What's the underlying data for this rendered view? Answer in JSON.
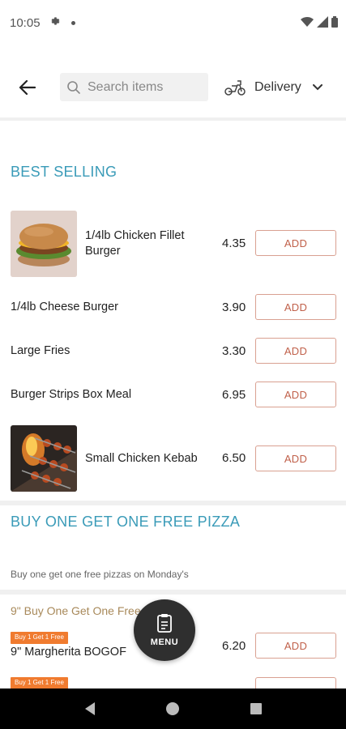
{
  "status_bar": {
    "time": "10:05"
  },
  "header": {
    "search_placeholder": "Search items",
    "delivery_label": "Delivery"
  },
  "sections": [
    {
      "title": "BEST SELLING",
      "items": [
        {
          "name": "1/4lb Chicken Fillet Burger",
          "price": "4.35",
          "add_label": "ADD"
        },
        {
          "name": "1/4lb Cheese Burger",
          "price": "3.90",
          "add_label": "ADD"
        },
        {
          "name": "Large Fries",
          "price": "3.30",
          "add_label": "ADD"
        },
        {
          "name": "Burger Strips Box Meal",
          "price": "6.95",
          "add_label": "ADD"
        },
        {
          "name": "Small Chicken Kebab",
          "price": "6.50",
          "add_label": "ADD"
        }
      ]
    },
    {
      "title": "BUY ONE GET ONE FREE PIZZA",
      "description": "Buy one get one free pizzas on Monday's",
      "subsection_title": "9\" Buy One Get One Free",
      "items": [
        {
          "badge": "Buy 1 Get 1 Free",
          "name": "9\" Margherita BOGOF",
          "price": "6.20",
          "add_label": "ADD"
        },
        {
          "badge": "Buy 1 Get 1 Free"
        }
      ]
    }
  ],
  "fab": {
    "label": "MENU"
  },
  "colors": {
    "accent": "#3a9bb8",
    "add_border": "#d9a091",
    "add_text": "#c0604a",
    "badge": "#f07b2f",
    "subsection": "#a8895a"
  }
}
